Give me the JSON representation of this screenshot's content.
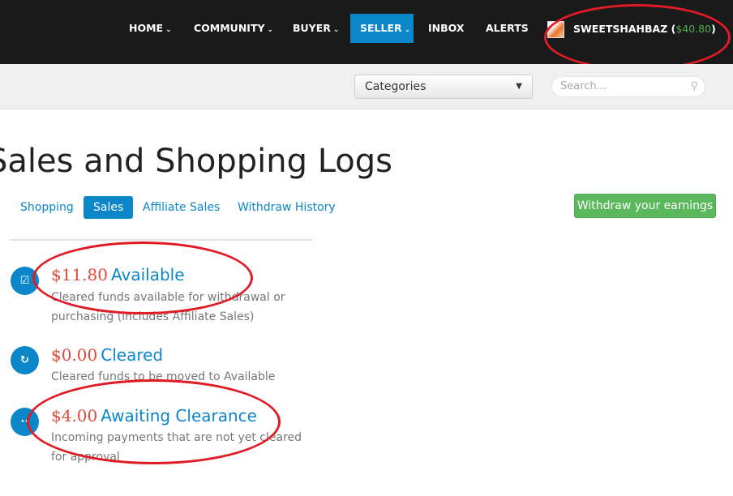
{
  "nav": {
    "items": [
      {
        "label": "HOME",
        "caret": true
      },
      {
        "label": "COMMUNITY",
        "caret": true
      },
      {
        "label": "BUYER",
        "caret": true
      },
      {
        "label": "SELLER",
        "caret": true
      },
      {
        "label": "INBOX",
        "caret": false
      },
      {
        "label": "ALERTS",
        "caret": false
      }
    ],
    "username": "SWEETSHAHBAZ",
    "balance": "$40.80"
  },
  "subbar": {
    "categories": "Categories",
    "search_placeholder": "Search..."
  },
  "page": {
    "title": "Sales and Shopping Logs",
    "tabs": [
      "Shopping",
      "Sales",
      "Affiliate Sales",
      "Withdraw History"
    ],
    "withdraw": "Withdraw your earnings"
  },
  "items": [
    {
      "amount": "$11.80",
      "label": "Available",
      "desc": "Cleared funds available for withdrawal or purchasing (includes Affiliate Sales)"
    },
    {
      "amount": "$0.00",
      "label": "Cleared",
      "desc": "Cleared funds to be moved to Available"
    },
    {
      "amount": "$4.00",
      "label": "Awaiting Clearance",
      "desc": "Incoming payments that are not yet cleared for approval"
    }
  ]
}
